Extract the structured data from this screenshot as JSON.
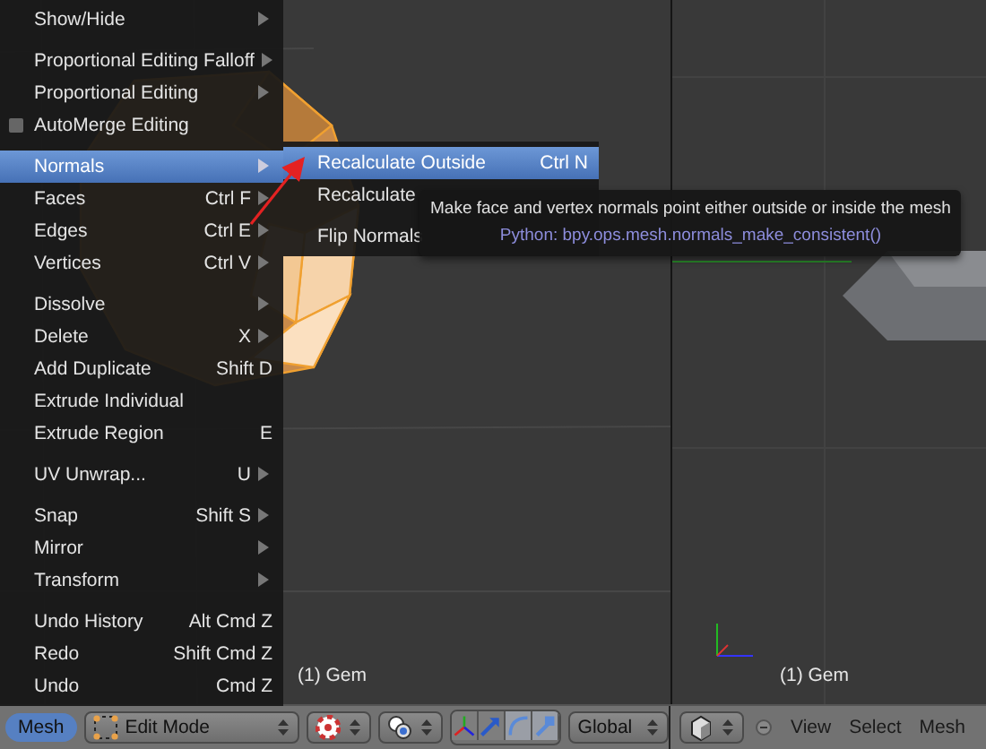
{
  "menu": {
    "groups": [
      [
        {
          "kind": "item",
          "label": "Show/Hide",
          "submenu": true,
          "selected": false
        }
      ],
      [
        {
          "kind": "item",
          "label": "Proportional Editing Falloff",
          "submenu": true,
          "selected": false
        },
        {
          "kind": "item",
          "label": "Proportional Editing",
          "submenu": true,
          "selected": false
        },
        {
          "kind": "checkbox",
          "label": "AutoMerge Editing",
          "checked": false,
          "selected": false
        }
      ],
      [
        {
          "kind": "item",
          "label": "Normals",
          "submenu": true,
          "selected": true
        },
        {
          "kind": "item",
          "label": "Faces",
          "shortcut": "Ctrl F",
          "submenu": true,
          "selected": false
        },
        {
          "kind": "item",
          "label": "Edges",
          "shortcut": "Ctrl E",
          "submenu": true,
          "selected": false
        },
        {
          "kind": "item",
          "label": "Vertices",
          "shortcut": "Ctrl V",
          "submenu": true,
          "selected": false
        }
      ],
      [
        {
          "kind": "item",
          "label": "Dissolve",
          "submenu": true,
          "selected": false
        },
        {
          "kind": "item",
          "label": "Delete",
          "shortcut": "X",
          "submenu": true,
          "selected": false
        },
        {
          "kind": "item",
          "label": "Add Duplicate",
          "shortcut": "Shift D",
          "submenu": false,
          "selected": false
        },
        {
          "kind": "item",
          "label": "Extrude Individual",
          "submenu": false,
          "selected": false
        },
        {
          "kind": "item",
          "label": "Extrude Region",
          "shortcut": "E",
          "submenu": false,
          "selected": false
        }
      ],
      [
        {
          "kind": "item",
          "label": "UV Unwrap...",
          "shortcut": "U",
          "submenu": true,
          "selected": false
        }
      ],
      [
        {
          "kind": "item",
          "label": "Snap",
          "shortcut": "Shift S",
          "submenu": true,
          "selected": false
        },
        {
          "kind": "item",
          "label": "Mirror",
          "submenu": true,
          "selected": false
        },
        {
          "kind": "item",
          "label": "Transform",
          "submenu": true,
          "selected": false
        }
      ],
      [
        {
          "kind": "item",
          "label": "Undo History",
          "shortcut": "Alt Cmd Z",
          "submenu": false,
          "selected": false
        },
        {
          "kind": "item",
          "label": "Redo",
          "shortcut": "Shift Cmd Z",
          "submenu": false,
          "selected": false
        },
        {
          "kind": "item",
          "label": "Undo",
          "shortcut": "Cmd Z",
          "submenu": false,
          "selected": false
        }
      ]
    ]
  },
  "submenu": {
    "groups": [
      [
        {
          "kind": "item",
          "label": "Recalculate Outside",
          "shortcut": "Ctrl N",
          "selected": true
        },
        {
          "kind": "item",
          "label": "Recalculate",
          "selected": false
        }
      ],
      [
        {
          "kind": "item",
          "label": "Flip Normals",
          "selected": false
        }
      ]
    ]
  },
  "tooltip": {
    "description": "Make face and vertex normals point either outside or inside the mesh",
    "python": "Python: bpy.ops.mesh.normals_make_consistent()"
  },
  "viewports_": [
    {
      "object_label": "(1) Gem"
    },
    {
      "object_label": "(1) Gem"
    }
  ],
  "header": {
    "mode_menu": {
      "label": "Mesh",
      "selected": true
    },
    "mode": "Edit Mode",
    "orientation": "Global",
    "right_menus": [
      "View",
      "Select",
      "Mesh"
    ]
  }
}
